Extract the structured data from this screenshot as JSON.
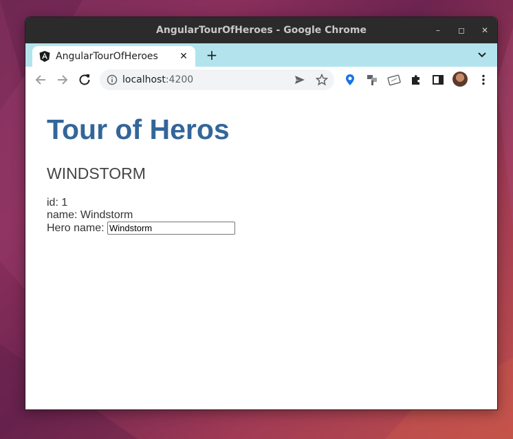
{
  "window": {
    "title": "AngularTourOfHeroes - Google Chrome"
  },
  "tab": {
    "title": "AngularTourOfHeroes"
  },
  "address_bar": {
    "host": "localhost",
    "port": ":4200"
  },
  "page": {
    "title": "Tour of Heros",
    "hero_heading": "WINDSTORM",
    "id_label": "id: ",
    "id_value": "1",
    "name_label": "name: ",
    "name_value": "Windstorm",
    "input_label": "Hero name: ",
    "input_value": "Windstorm"
  },
  "colors": {
    "title": "#336699",
    "tabstrip": "#b3e4ee",
    "titlebar": "#2b2b2b"
  },
  "icons": [
    "angular-favicon-icon",
    "close-icon",
    "plus-icon",
    "chevron-down-icon",
    "back-arrow-icon",
    "forward-arrow-icon",
    "reload-icon",
    "info-icon",
    "send-icon",
    "star-icon",
    "extension-icon",
    "puzzle-icon",
    "side-panel-icon",
    "avatar",
    "more-vert-icon",
    "minimize-icon",
    "maximize-icon"
  ]
}
